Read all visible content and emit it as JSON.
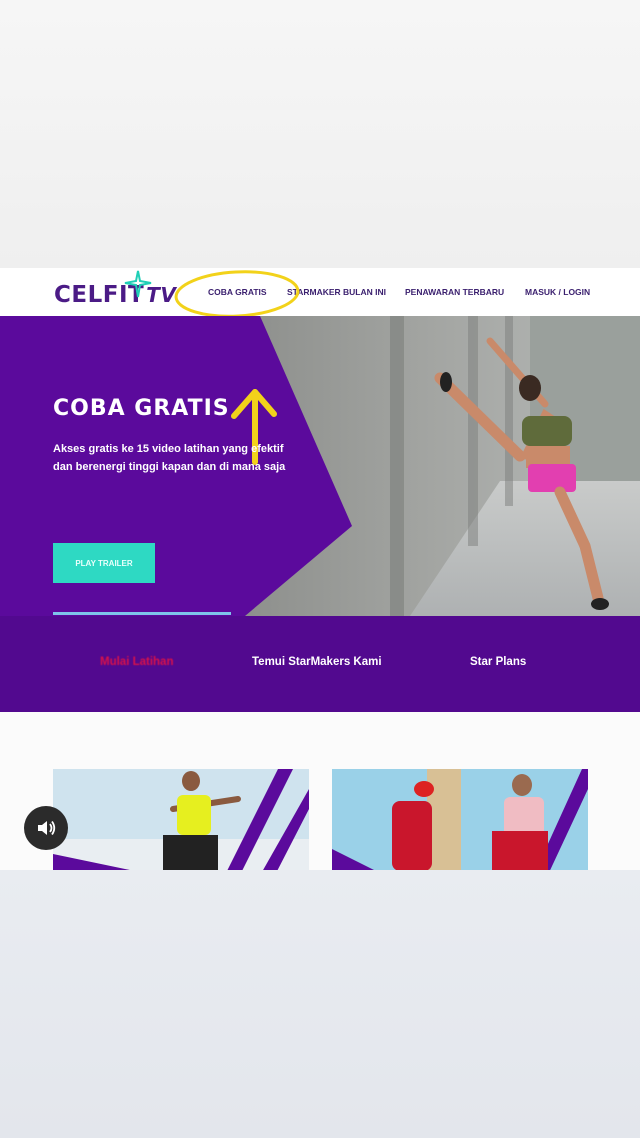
{
  "header": {
    "logo_text": "CELFIT",
    "logo_suffix": "TV",
    "nav": [
      {
        "label": "COBA GRATIS"
      },
      {
        "label": "STARMAKER BULAN INI"
      },
      {
        "label": "PENAWARAN TERBARU"
      },
      {
        "label": "MASUK / LOGIN"
      }
    ]
  },
  "hero": {
    "title": "COBA GRATIS",
    "description_line1": "Akses gratis ke 15 video latihan yang efektif",
    "description_line2": "dan berenergi tinggi kapan dan di mana saja",
    "cta_label": "PLAY TRAILER"
  },
  "tabs": [
    {
      "label": "Mulai Latihan"
    },
    {
      "label": "Temui StarMakers Kami"
    },
    {
      "label": "Star Plans"
    }
  ],
  "colors": {
    "brand_purple": "#5b0a9c",
    "accent_teal": "#2ed9c3",
    "annotation_yellow": "#f2d21a",
    "active_tab": "#d8124a"
  },
  "icons": {
    "sound": "speaker-icon",
    "annotation": "arrow-up-icon"
  }
}
